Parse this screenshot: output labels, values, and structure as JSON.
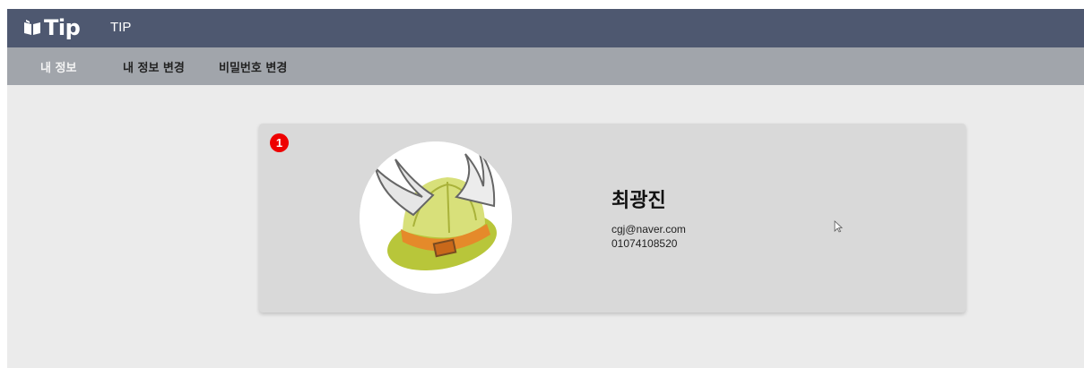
{
  "header": {
    "logo_text": "Tip",
    "app_title": "TIP",
    "background_color": "#4e5870"
  },
  "subnav": {
    "items": [
      {
        "label": "내 정보",
        "active": true
      },
      {
        "label": "내 정보 변경",
        "active": false
      },
      {
        "label": "비밀번호 변경",
        "active": false
      }
    ],
    "background_color": "#a1a5ab"
  },
  "profile": {
    "badge": "1",
    "avatar_icon": "winged-helmet-icon",
    "name": "최광진",
    "email": "cgj@naver.com",
    "phone": "01074108520"
  },
  "colors": {
    "page_background": "#ebebeb",
    "card_background": "#d9d9d9",
    "badge_color": "#ee0000"
  }
}
